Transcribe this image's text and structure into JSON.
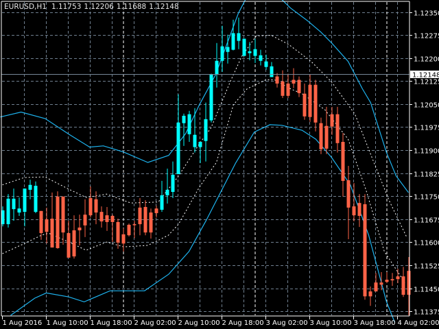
{
  "header": {
    "symbol": "EURUSD,H1",
    "open": "1.11753",
    "high": "1.12206",
    "low": "1.11688",
    "close": "1.12148"
  },
  "colors": {
    "background": "#000000",
    "bull": "#00ffff",
    "bear": "#ff6347",
    "grid": "#708090",
    "band_outer": "#1eb4f0",
    "band_inner": "#ffffff",
    "price_line": "#778899"
  },
  "current_price_label": "1.12148",
  "chart_data": {
    "type": "candlestick",
    "symbol": "EURUSD",
    "timeframe": "H1",
    "ylim": [
      1.11375,
      1.1235
    ],
    "price_ticks": [
      "1.12350",
      "1.12275",
      "1.12200",
      "1.12125",
      "1.12050",
      "1.11975",
      "1.11900",
      "1.11825",
      "1.11750",
      "1.11675",
      "1.11600",
      "1.11525",
      "1.11450",
      "1.11375"
    ],
    "time_labels": [
      "1 Aug 2016",
      "1 Aug 10:00",
      "1 Aug 18:00",
      "2 Aug 02:00",
      "2 Aug 10:00",
      "2 Aug 18:00",
      "3 Aug 02:00",
      "3 Aug 10:00",
      "3 Aug 18:00",
      "4 Aug 02:00"
    ],
    "bars_per_time_label": 8,
    "day_separator_bars": [
      22,
      46,
      70
    ],
    "current_price": 1.12148,
    "candles_ohlc": [
      [
        1.11659,
        1.11717,
        1.11652,
        1.11704
      ],
      [
        1.11659,
        1.11757,
        1.11648,
        1.11742
      ],
      [
        1.11708,
        1.11775,
        1.1167,
        1.11742
      ],
      [
        1.11697,
        1.11746,
        1.11686,
        1.1171
      ],
      [
        1.11699,
        1.11775,
        1.11652,
        1.11775
      ],
      [
        1.11771,
        1.11804,
        1.1174,
        1.11787
      ],
      [
        1.11699,
        1.11798,
        1.11695,
        1.11784
      ],
      [
        1.11702,
        1.11702,
        1.11608,
        1.1163
      ],
      [
        1.11675,
        1.11713,
        1.11596,
        1.11634
      ],
      [
        1.11677,
        1.11762,
        1.11583,
        1.11583
      ],
      [
        1.11749,
        1.11766,
        1.11579,
        1.11581
      ],
      [
        1.11749,
        1.11749,
        1.11592,
        1.11632
      ],
      [
        1.1163,
        1.1167,
        1.1155,
        1.1155
      ],
      [
        1.11639,
        1.11688,
        1.11547,
        1.11554
      ],
      [
        1.11648,
        1.1169,
        1.1159,
        1.11639
      ],
      [
        1.1169,
        1.1174,
        1.11617,
        1.11655
      ],
      [
        1.11744,
        1.11782,
        1.11681,
        1.11688
      ],
      [
        1.1174,
        1.11766,
        1.11659,
        1.11697
      ],
      [
        1.11699,
        1.11717,
        1.11648,
        1.11668
      ],
      [
        1.11688,
        1.11715,
        1.11637,
        1.11666
      ],
      [
        1.11686,
        1.1169,
        1.11601,
        1.11666
      ],
      [
        1.11666,
        1.11677,
        1.11579,
        1.11599
      ],
      [
        1.11626,
        1.11646,
        1.1157,
        1.11596
      ],
      [
        1.11657,
        1.11661,
        1.11619,
        1.11623
      ],
      [
        1.11659,
        1.1167,
        1.11614,
        1.11658
      ],
      [
        1.11713,
        1.11744,
        1.11623,
        1.11659
      ],
      [
        1.11715,
        1.11737,
        1.11623,
        1.11632
      ],
      [
        1.11697,
        1.1171,
        1.11612,
        1.11632
      ],
      [
        1.1171,
        1.11719,
        1.11681,
        1.11695
      ],
      [
        1.11706,
        1.118,
        1.11699,
        1.11753
      ],
      [
        1.11753,
        1.1184,
        1.11726,
        1.11771
      ],
      [
        1.11764,
        1.11863,
        1.11744,
        1.1182
      ],
      [
        1.11822,
        1.12082,
        1.11822,
        1.1199
      ],
      [
        1.11988,
        1.12019,
        1.11914,
        1.12012
      ],
      [
        1.11952,
        1.12028,
        1.11927,
        1.12017
      ],
      [
        1.1191,
        1.12037,
        1.11892,
        1.1195
      ],
      [
        1.1191,
        1.11927,
        1.11858,
        1.11927
      ],
      [
        1.1193,
        1.12055,
        1.11863,
        1.12001
      ],
      [
        1.11997,
        1.12149,
        1.1199,
        1.12146
      ],
      [
        1.12146,
        1.12249,
        1.12104,
        1.12191
      ],
      [
        1.12191,
        1.12305,
        1.12155,
        1.12238
      ],
      [
        1.1222,
        1.12276,
        1.12182,
        1.12236
      ],
      [
        1.12227,
        1.12325,
        1.12225,
        1.12281
      ],
      [
        1.12256,
        1.12332,
        1.12229,
        1.12281
      ],
      [
        1.12207,
        1.12263,
        1.12207,
        1.12263
      ],
      [
        1.12216,
        1.12252,
        1.12193,
        1.12222
      ],
      [
        1.12207,
        1.12263,
        1.12184,
        1.12229
      ],
      [
        1.12191,
        1.12227,
        1.12176,
        1.12209
      ],
      [
        1.12171,
        1.12211,
        1.12162,
        1.12189
      ],
      [
        1.12138,
        1.12187,
        1.12138,
        1.12173
      ],
      [
        1.1214,
        1.12151,
        1.12104,
        1.12117
      ],
      [
        1.12124,
        1.1216,
        1.1207,
        1.12077
      ],
      [
        1.12117,
        1.12149,
        1.1207,
        1.12077
      ],
      [
        1.12129,
        1.12167,
        1.12102,
        1.12117
      ],
      [
        1.12129,
        1.1214,
        1.12073,
        1.12086
      ],
      [
        1.12084,
        1.12117,
        1.11999,
        1.1201
      ],
      [
        1.12113,
        1.12146,
        1.11992,
        1.12008
      ],
      [
        1.12113,
        1.12129,
        1.11961,
        1.1199
      ],
      [
        1.11988,
        1.12006,
        1.11887,
        1.11903
      ],
      [
        1.11979,
        1.12041,
        1.11887,
        1.11905
      ],
      [
        1.12017,
        1.12041,
        1.1195,
        1.11977
      ],
      [
        1.12017,
        1.12041,
        1.11892,
        1.11923
      ],
      [
        1.11927,
        1.11956,
        1.11749,
        1.118
      ],
      [
        1.11802,
        1.11849,
        1.1161,
        1.11713
      ],
      [
        1.11717,
        1.11793,
        1.11668,
        1.11688
      ],
      [
        1.11728,
        1.11757,
        1.1165,
        1.11686
      ],
      [
        1.11724,
        1.11757,
        1.11413,
        1.11424
      ],
      [
        1.1144,
        1.11456,
        1.11393,
        1.11424
      ],
      [
        1.11469,
        1.115,
        1.1144,
        1.1144
      ],
      [
        1.11469,
        1.11503,
        1.11444,
        1.11462
      ],
      [
        1.11478,
        1.11503,
        1.11467,
        1.11471
      ],
      [
        1.1148,
        1.115,
        1.11458,
        1.11476
      ],
      [
        1.11489,
        1.11514,
        1.11467,
        1.1148
      ],
      [
        1.11489,
        1.1152,
        1.11422,
        1.11429
      ],
      [
        1.11507,
        1.11552,
        1.11362,
        1.11429
      ]
    ],
    "bands": [
      {
        "name": "upper-outer-band",
        "style": "solid",
        "points": [
          [
            -0.4,
            1.12008
          ],
          [
            3.4,
            1.12024
          ],
          [
            7.8,
            1.12003
          ],
          [
            12.1,
            1.11952
          ],
          [
            15.9,
            1.1191
          ],
          [
            18.4,
            1.11914
          ],
          [
            22.1,
            1.11894
          ],
          [
            26.5,
            1.1186
          ],
          [
            30.3,
            1.11883
          ],
          [
            33.4,
            1.11954
          ],
          [
            35.9,
            1.12048
          ],
          [
            38.8,
            1.12144
          ],
          [
            43,
            1.12346
          ],
          [
            45.9,
            1.12446
          ],
          [
            49,
            1.12424
          ],
          [
            52.5,
            1.12363
          ],
          [
            55.5,
            1.12323
          ],
          [
            58,
            1.12285
          ],
          [
            60,
            1.12249
          ],
          [
            63,
            1.12189
          ],
          [
            65.6,
            1.121
          ],
          [
            67.1,
            1.12055
          ],
          [
            70,
            1.11892
          ],
          [
            71.75,
            1.11816
          ],
          [
            74,
            1.11762
          ]
        ]
      },
      {
        "name": "lower-outer-band",
        "style": "solid",
        "points": [
          [
            1.5,
            1.11362
          ],
          [
            5.9,
            1.11418
          ],
          [
            8,
            1.11435
          ],
          [
            12.1,
            1.11422
          ],
          [
            14.9,
            1.11406
          ],
          [
            19.6,
            1.11442
          ],
          [
            22.1,
            1.11442
          ],
          [
            25.9,
            1.11442
          ],
          [
            30.3,
            1.11496
          ],
          [
            34,
            1.1157
          ],
          [
            37.1,
            1.1167
          ],
          [
            42.5,
            1.11858
          ],
          [
            45.9,
            1.11959
          ],
          [
            48.75,
            1.11983
          ],
          [
            50.9,
            1.11981
          ],
          [
            54.6,
            1.11965
          ],
          [
            57.1,
            1.11936
          ],
          [
            60,
            1.11876
          ],
          [
            63.4,
            1.11787
          ],
          [
            66.75,
            1.11623
          ],
          [
            70,
            1.11406
          ],
          [
            71.5,
            1.11339
          ]
        ]
      },
      {
        "name": "upper-inner-band",
        "style": "dotted",
        "points": [
          [
            0,
            1.11787
          ],
          [
            4,
            1.11811
          ],
          [
            7.75,
            1.11813
          ],
          [
            12.1,
            1.11773
          ],
          [
            15.25,
            1.11746
          ],
          [
            19,
            1.11757
          ],
          [
            23.4,
            1.11728
          ],
          [
            28.4,
            1.11731
          ],
          [
            32.1,
            1.11816
          ],
          [
            35.9,
            1.11921
          ],
          [
            38,
            1.11972
          ],
          [
            41.5,
            1.12122
          ],
          [
            43.6,
            1.12205
          ],
          [
            46.25,
            1.12272
          ],
          [
            49,
            1.12274
          ],
          [
            52.1,
            1.12245
          ],
          [
            56.25,
            1.12189
          ],
          [
            60,
            1.12122
          ],
          [
            64.25,
            1.12017
          ],
          [
            67.5,
            1.11869
          ],
          [
            70.5,
            1.11735
          ],
          [
            73.75,
            1.11614
          ]
        ]
      },
      {
        "name": "lower-inner-band",
        "style": "dotted",
        "points": [
          [
            0,
            1.11563
          ],
          [
            4,
            1.11596
          ],
          [
            7.1,
            1.11623
          ],
          [
            8.4,
            1.1163
          ],
          [
            12.1,
            1.11601
          ],
          [
            15.25,
            1.11574
          ],
          [
            19,
            1.11601
          ],
          [
            22.1,
            1.11585
          ],
          [
            26.5,
            1.1159
          ],
          [
            30.25,
            1.11623
          ],
          [
            32.1,
            1.11659
          ],
          [
            35.9,
            1.1178
          ],
          [
            39,
            1.1186
          ],
          [
            42.1,
            1.12048
          ],
          [
            44.6,
            1.121
          ],
          [
            48,
            1.12129
          ],
          [
            49.6,
            1.12129
          ],
          [
            52.5,
            1.121
          ],
          [
            54.6,
            1.12084
          ],
          [
            58.75,
            1.12032
          ],
          [
            63,
            1.11936
          ],
          [
            66.25,
            1.11771
          ],
          [
            69.6,
            1.1157
          ],
          [
            73.4,
            1.11467
          ]
        ]
      }
    ]
  }
}
